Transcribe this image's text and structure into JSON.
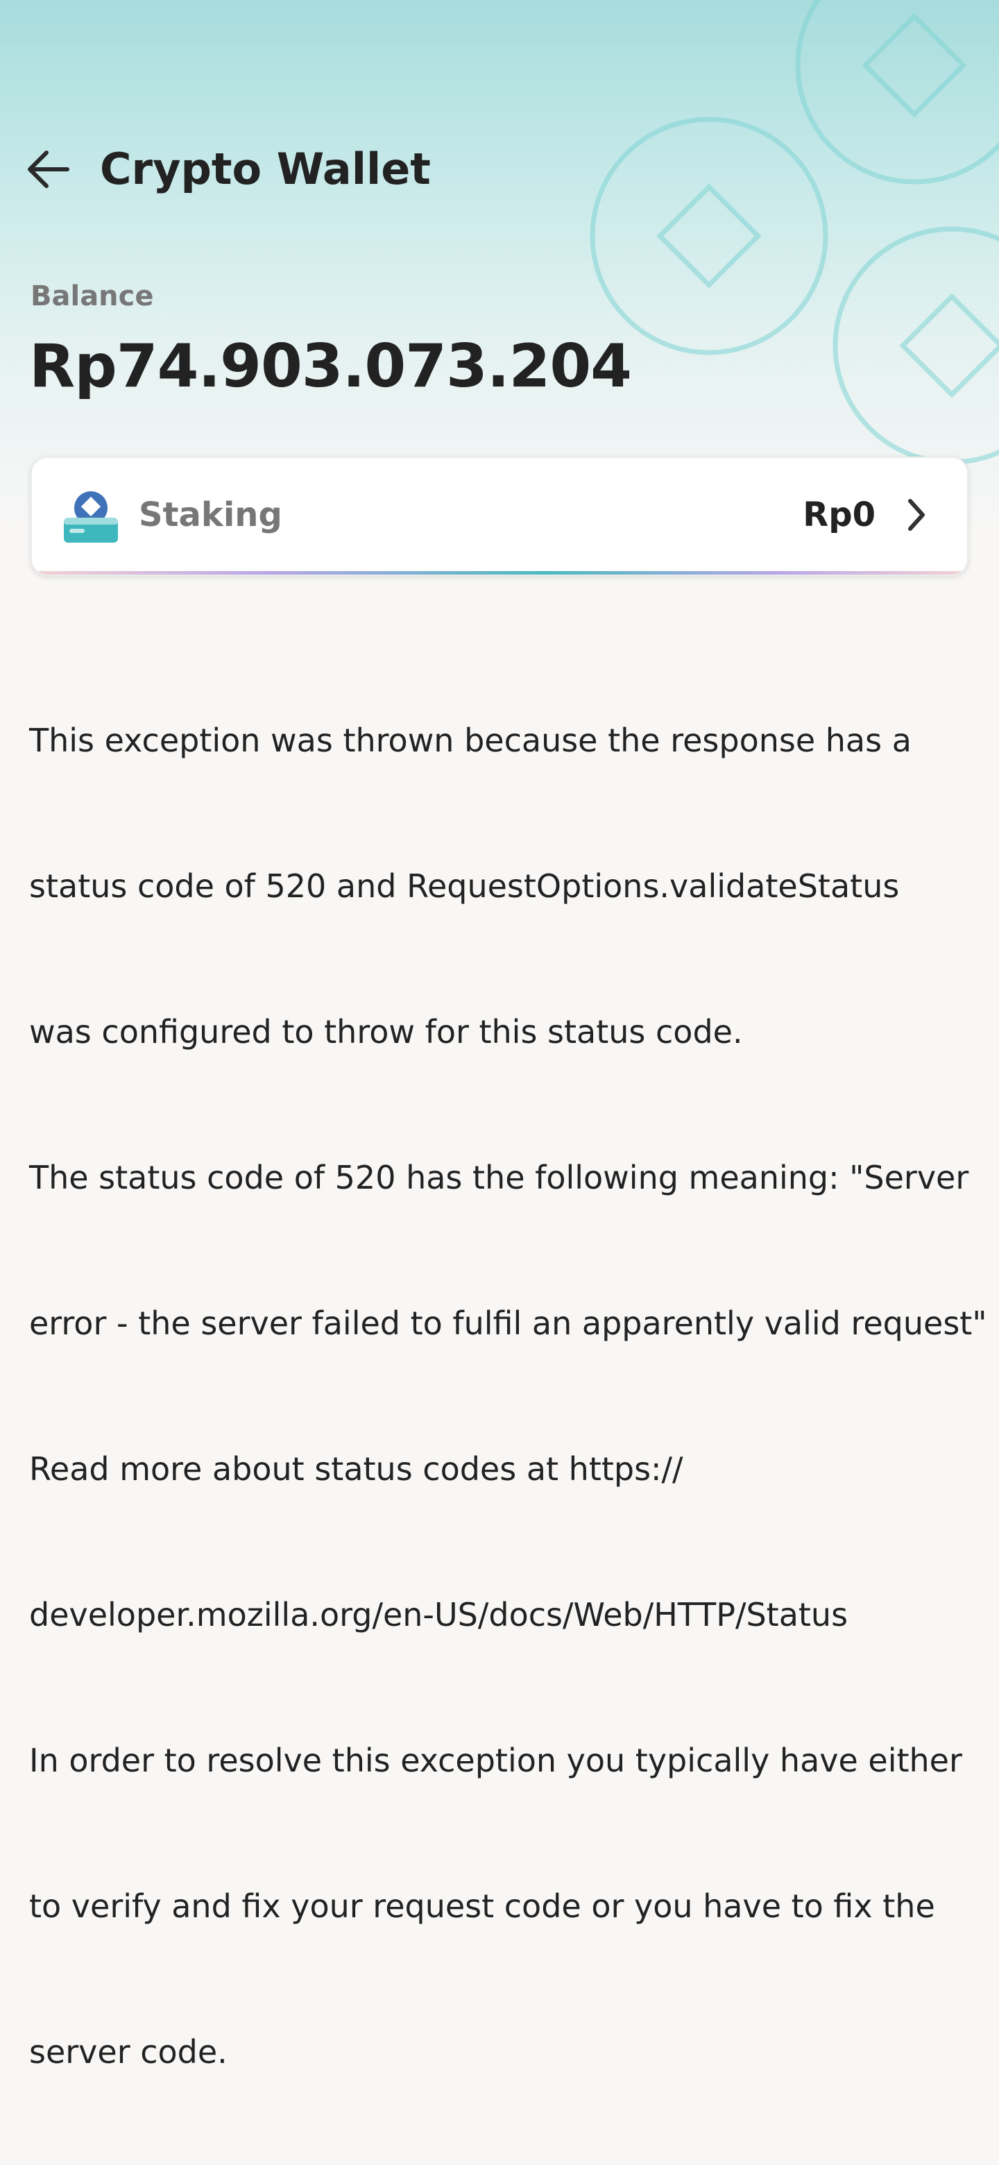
{
  "header": {
    "title": "Crypto Wallet",
    "back_icon": "arrow-left-icon"
  },
  "balance": {
    "label": "Balance",
    "value": "Rp74.903.073.204"
  },
  "staking": {
    "icon": "staking-icon",
    "label": "Staking",
    "value": "Rp0",
    "chevron_icon": "chevron-right-icon"
  },
  "error": {
    "lines": [
      "This exception was thrown because the response has a",
      "status code of 520 and RequestOptions.validateStatus",
      "was configured to throw for this status code.",
      "The status code of 520 has the following meaning: \"Server",
      "error - the server failed to fulfil an apparently valid request\"",
      "Read more about status codes at https://",
      "developer.mozilla.org/en-US/docs/Web/HTTP/Status",
      "In order to resolve this exception you typically have either",
      "to verify and fix your request code or you have to fix the",
      "server code."
    ]
  },
  "colors": {
    "header_gradient_top": "#a7dcdc",
    "background": "#f8f7f6",
    "text_primary": "#222222",
    "text_secondary": "#777777",
    "accent_teal": "#4bbbbf"
  }
}
